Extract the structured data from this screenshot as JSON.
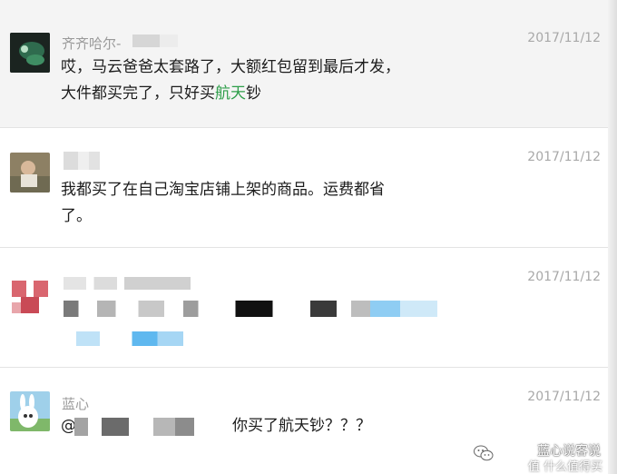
{
  "comments": [
    {
      "name": "齐齐哈尔-",
      "date": "2017/11/12",
      "text_a": "哎，马云爸爸太套路了，大额红包留到最后才发，",
      "text_b": "大件都买完了，只好买",
      "highlight": "航天",
      "text_c": "钞"
    },
    {
      "name": "",
      "date": "2017/11/12",
      "text_a": "我都买了在自己淘宝店铺上架的商品。运费都省",
      "text_b": "了。"
    },
    {
      "name": "",
      "date": "2017/11/12"
    },
    {
      "name": "蓝心",
      "date": "2017/11/12",
      "mention": "@",
      "text_a": "你买了航天钞？？？"
    }
  ],
  "watermark": {
    "channel": "蓝心说客说",
    "site": "值 什么值得买"
  },
  "colors": {
    "highlight_green": "#2e9e4a",
    "blur_blue": "#5fb8ef"
  },
  "icons": [
    "avatar-image",
    "wechat-icon"
  ]
}
